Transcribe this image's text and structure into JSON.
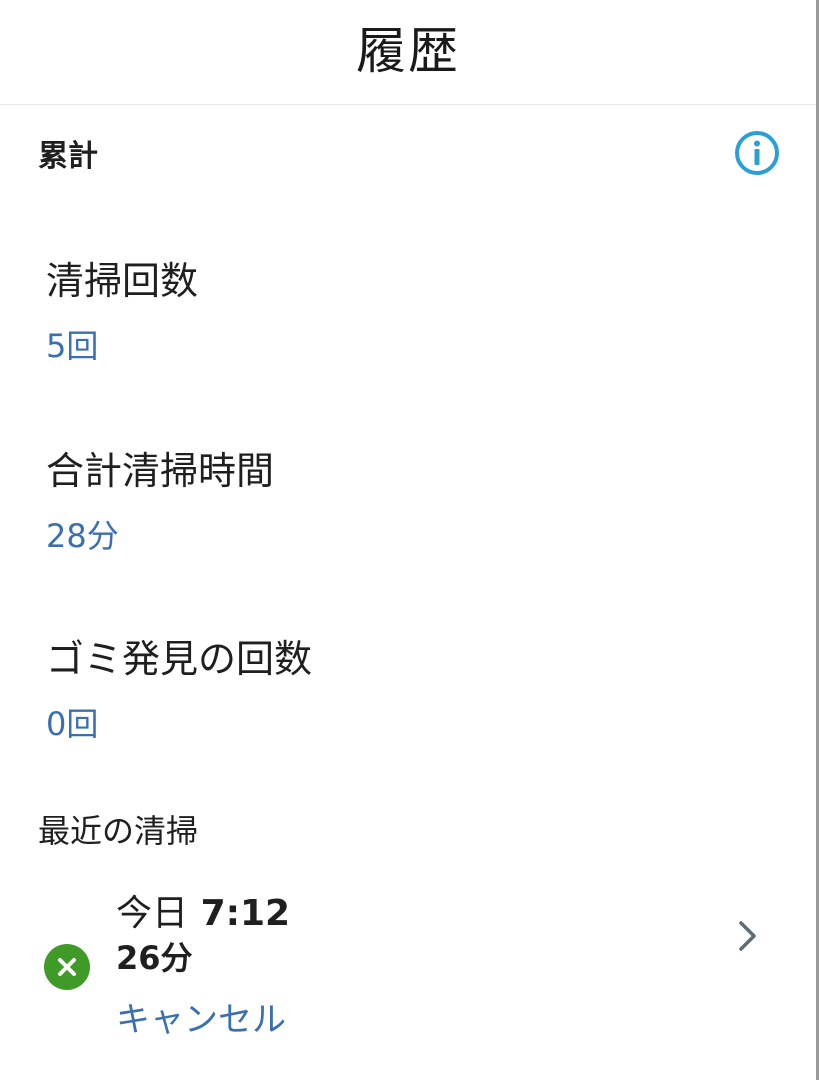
{
  "header": {
    "title": "履歴"
  },
  "summary": {
    "title": "累計",
    "info_icon": "info-icon",
    "stats": [
      {
        "label": "清掃回数",
        "value": "5回"
      },
      {
        "label": "合計清掃時間",
        "value": "28分"
      },
      {
        "label": "ゴミ発見の回数",
        "value": "0回"
      }
    ]
  },
  "recent": {
    "title": "最近の清掃",
    "items": [
      {
        "day": "今日",
        "time": "7:12",
        "duration": "26分",
        "status": "キャンセル",
        "status_icon": "cancel-icon",
        "status_color": "#3f9a28"
      }
    ]
  },
  "colors": {
    "accent_blue": "#3a6fb0",
    "info_blue": "#2a9fd6",
    "status_green": "#3f9a28"
  }
}
